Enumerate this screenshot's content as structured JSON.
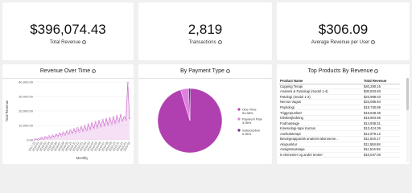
{
  "kpis": [
    {
      "value": "$396,074.43",
      "label": "Total Revenue"
    },
    {
      "value": "2,819",
      "label": "Transactions"
    },
    {
      "value": "$306.09",
      "label": "Average Revenue per User"
    }
  ],
  "info_glyph": "i",
  "revenue_chart": {
    "title": "Revenue Over Time",
    "chart_data": {
      "type": "area",
      "title": "Revenue Over Time",
      "xlabel": "Monthly",
      "ylabel": "Total Revenue",
      "ylim": [
        0,
        40000
      ],
      "yticks": [
        "0.00",
        "10,000.00",
        "20,000.00",
        "30,000.00",
        "40,000.00"
      ],
      "xticks": [
        "2017-12",
        "2018-01",
        "2018-02",
        "2018-03",
        "2018-04",
        "2018-05",
        "2018-06",
        "2018-07",
        "2018-08",
        "2018-09",
        "2018-10",
        "2018-11",
        "2018-12",
        "2019-01",
        "2019-02",
        "2019-03",
        "2019-04",
        "2019-05",
        "2019-06",
        "2019-07",
        "2019-08",
        "2019-09",
        "2019-10",
        "2019-11",
        "2019-12",
        "2020-01",
        "2020-02"
      ],
      "color": "#cc66cc",
      "values": [
        200,
        500,
        300,
        800,
        1500,
        700,
        2000,
        1200,
        2600,
        1400,
        3200,
        2000,
        3800,
        2600,
        4600,
        3000,
        5200,
        3600,
        6000,
        4200,
        6800,
        4600,
        7400,
        5200,
        8200,
        5800,
        9000,
        6200,
        9800,
        6600,
        10800,
        7400,
        11800,
        8000,
        12600,
        8600,
        13200,
        9200,
        14000,
        9800,
        14600,
        10400,
        15200,
        11000,
        15800,
        11600,
        16600,
        12400,
        17400,
        13200,
        16000,
        14000,
        39500,
        15000
      ]
    }
  },
  "payment_chart": {
    "title": "By Payment Type",
    "chart_data": {
      "type": "pie",
      "title": "By Payment Type",
      "slices": [
        {
          "name": "One-Time",
          "pct": "94.98%",
          "value": 94.98,
          "color": "#b040b0"
        },
        {
          "name": "Payment Plan",
          "pct": "4.06%",
          "value": 4.06,
          "color": "#e080e0"
        },
        {
          "name": "Subscription",
          "pct": "0.96%",
          "value": 0.96,
          "color": "#6a2a8a"
        }
      ]
    }
  },
  "products": {
    "title": "Top Products By Revenue",
    "columns": [
      "Product Name",
      "Total Revenue"
    ],
    "rows": [
      [
        "Cupping Terapi",
        "$40,290.15"
      ],
      [
        "Anatomi & Fysiologi (modul 1-4)",
        "$30,833.93"
      ],
      [
        "Patologi (modul 1-2)",
        "$23,989.03"
      ],
      [
        "Nervus Vagus",
        "$23,086.94"
      ],
      [
        "Psykologi",
        "$19,730.89"
      ],
      [
        "Triggerpunkter",
        "$19,638.36"
      ],
      [
        "Klinikvejledning",
        "$16,904.96"
      ],
      [
        "Fodmassage",
        "$14,938.31"
      ],
      [
        "Kinesiologi-tape Kursus",
        "$13,424.39"
      ],
      [
        "Aurikuloterapi",
        "$12,979.12"
      ],
      [
        "Bevægeapparats anatomi-abonneme...",
        "$11,618.17"
      ],
      [
        "Akupunktur",
        "$11,558.98"
      ],
      [
        "Ansigtsmassage",
        "$11,516.59"
      ],
      [
        "5 elementer og andre teorier",
        "$10,037.06"
      ]
    ]
  }
}
